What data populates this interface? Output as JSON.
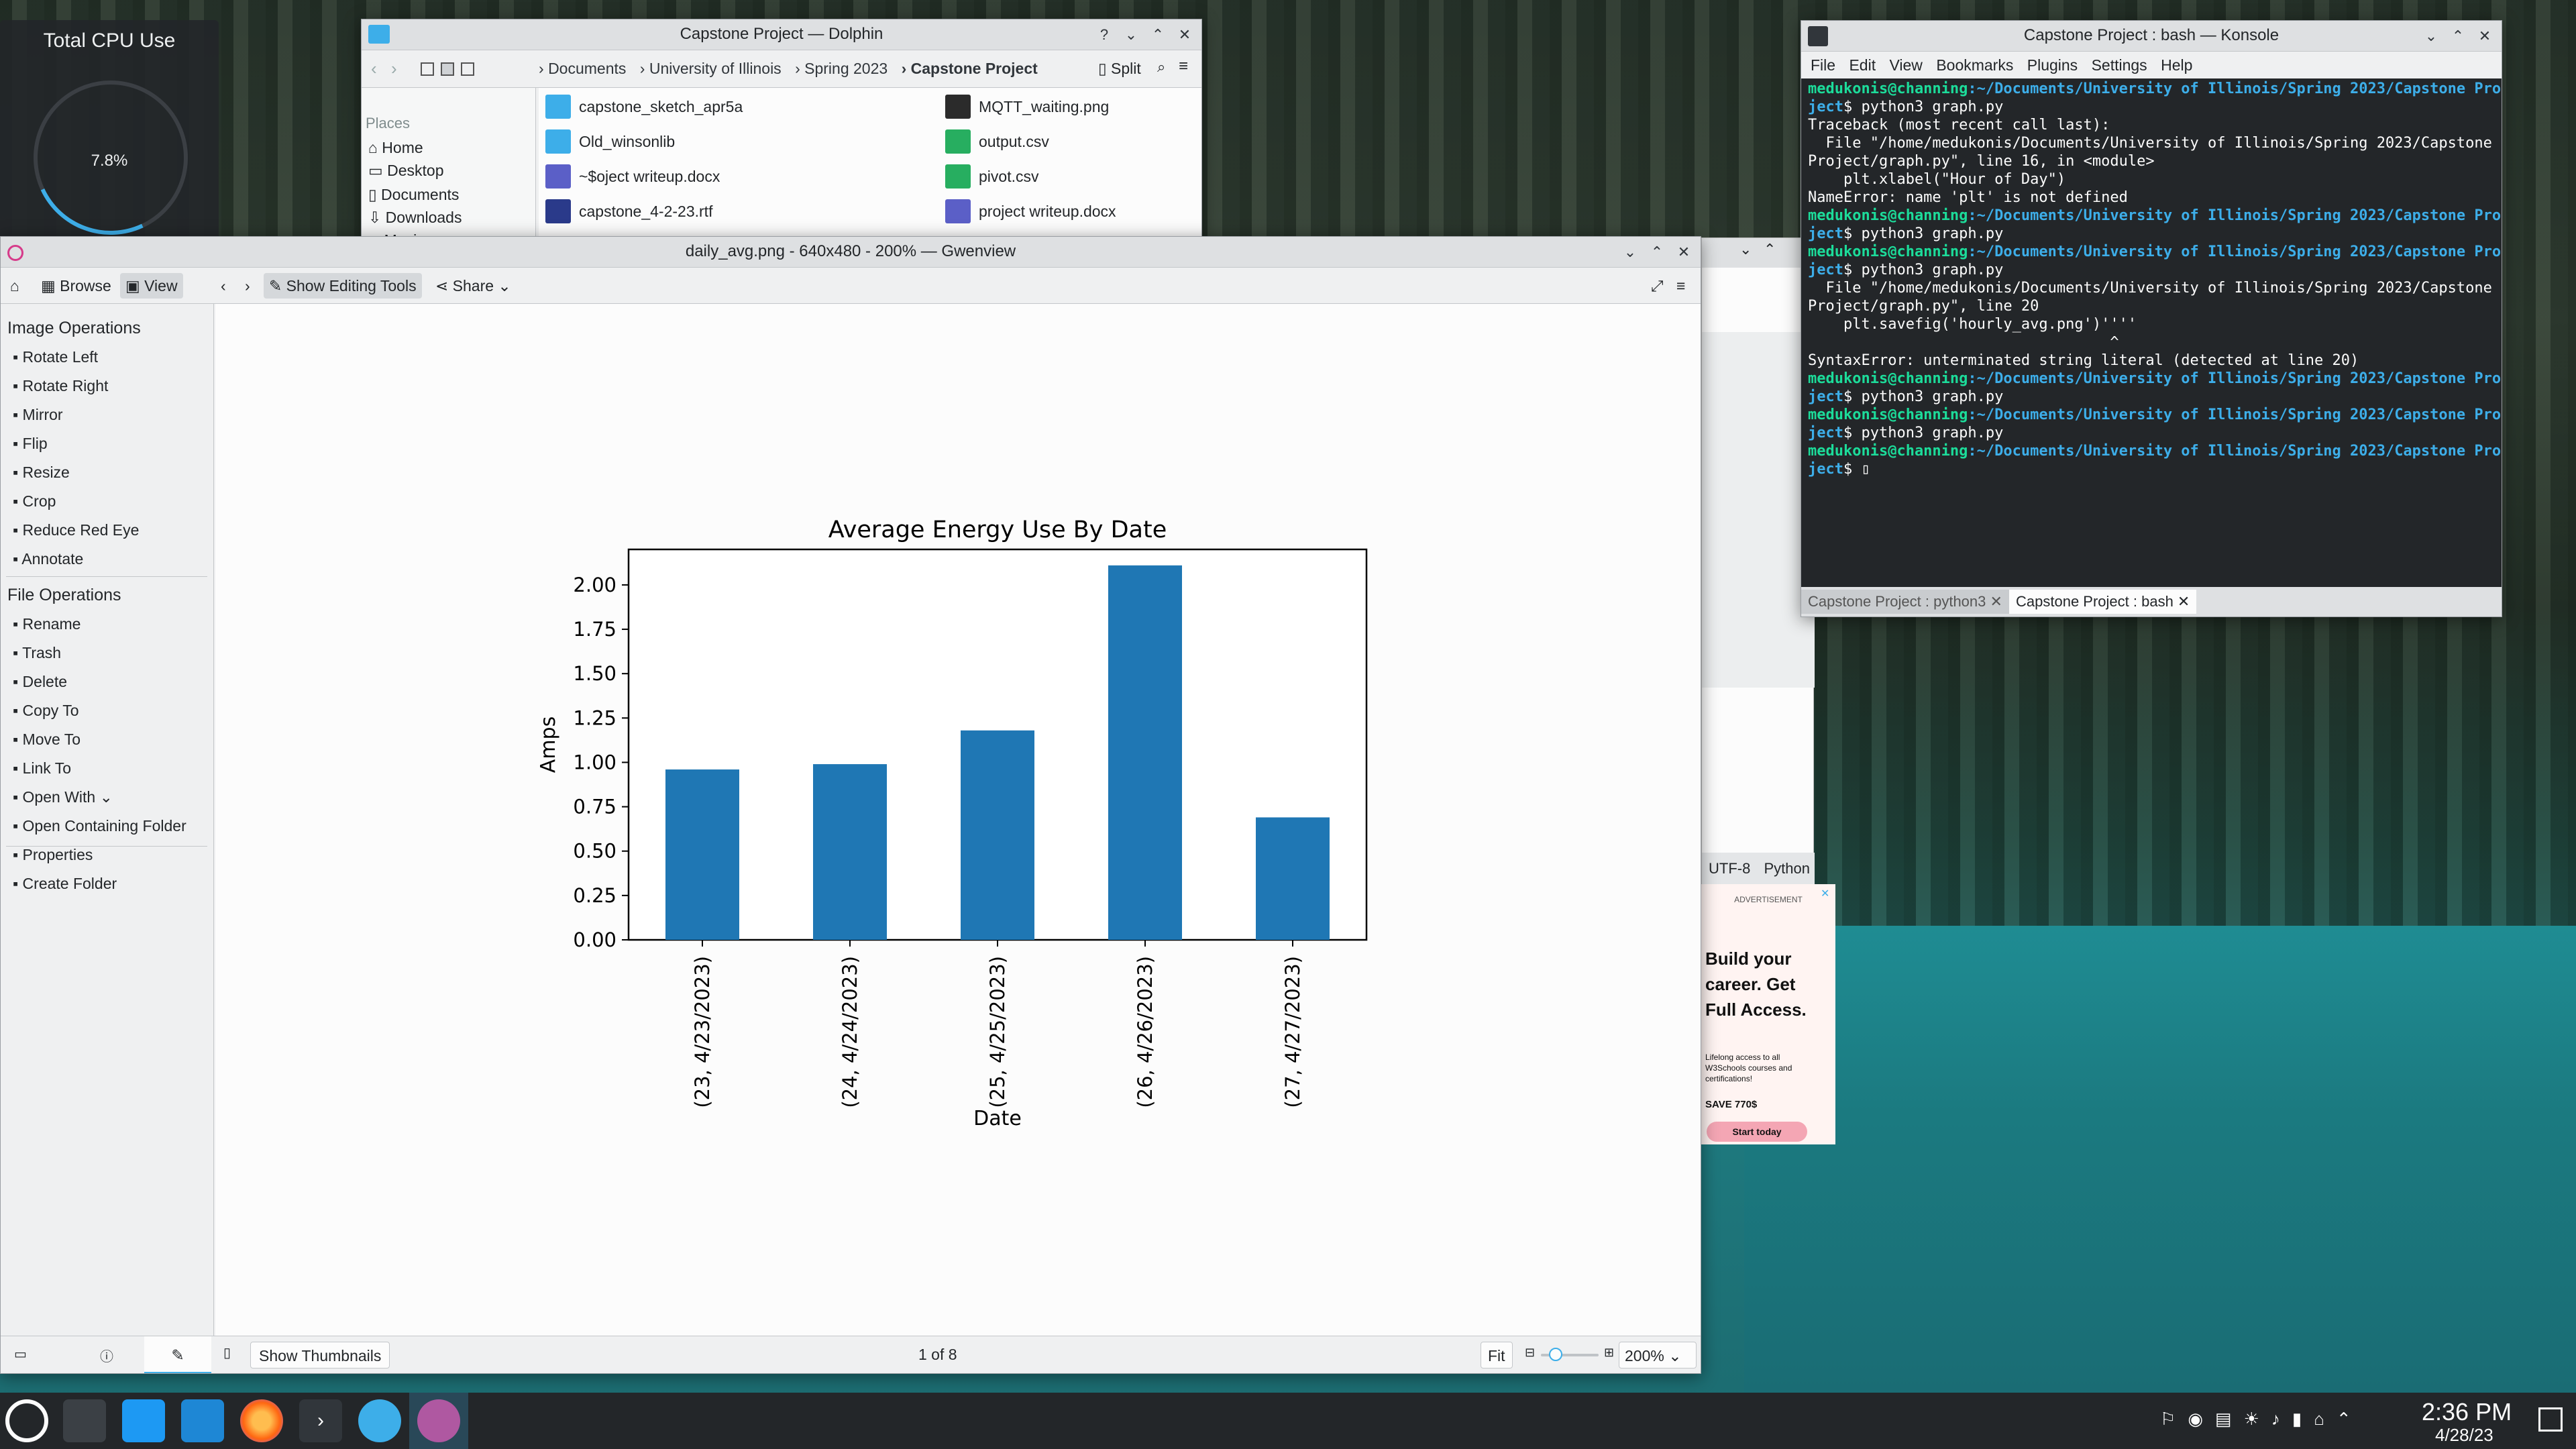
{
  "desktop": {
    "cpu_widget": {
      "title": "Total CPU Use",
      "value": "7.8%"
    }
  },
  "dolphin": {
    "title": "Capstone Project — Dolphin",
    "split_label": "Split",
    "breadcrumb": [
      "Documents",
      "University of Illinois",
      "Spring 2023",
      "Capstone Project"
    ],
    "places_header": "Places",
    "places": [
      "Home",
      "Desktop",
      "Documents",
      "Downloads",
      "Music"
    ],
    "files_left": [
      "capstone_sketch_apr5a",
      "Old_winsonlib",
      "~$oject writeup.docx",
      "capstone_4-2-23.rtf"
    ],
    "files_right": [
      "MQTT_waiting.png",
      "output.csv",
      "pivot.csv",
      "project writeup.docx"
    ]
  },
  "konsole": {
    "title": "Capstone Project : bash — Konsole",
    "menu": [
      "File",
      "Edit",
      "View",
      "Bookmarks",
      "Plugins",
      "Settings",
      "Help"
    ],
    "lines": [
      {
        "p": "medukonis@channing",
        "u": ":~/Documents/University of Illinois/Spring 2023/Capstone Pro"
      },
      {
        "u2": "ject",
        "t": "$ python3 graph.py"
      },
      {
        "t": "Traceback (most recent call last):"
      },
      {
        "t": "  File \"/home/medukonis/Documents/University of Illinois/Spring 2023/Capstone"
      },
      {
        "t": "Project/graph.py\", line 16, in <module>"
      },
      {
        "t": "    plt.xlabel(\"Hour of Day\")"
      },
      {
        "t": "NameError: name 'plt' is not defined"
      },
      {
        "p": "medukonis@channing",
        "u": ":~/Documents/University of Illinois/Spring 2023/Capstone Pro"
      },
      {
        "u2": "ject",
        "t": "$ python3 graph.py"
      },
      {
        "p": "medukonis@channing",
        "u": ":~/Documents/University of Illinois/Spring 2023/Capstone Pro"
      },
      {
        "u2": "ject",
        "t": "$ python3 graph.py"
      },
      {
        "t": "  File \"/home/medukonis/Documents/University of Illinois/Spring 2023/Capstone"
      },
      {
        "t": "Project/graph.py\", line 20"
      },
      {
        "t": "    plt.savefig('hourly_avg.png')''''"
      },
      {
        "t": "                                  ^"
      },
      {
        "t": "SyntaxError: unterminated string literal (detected at line 20)"
      },
      {
        "p": "medukonis@channing",
        "u": ":~/Documents/University of Illinois/Spring 2023/Capstone Pro"
      },
      {
        "u2": "ject",
        "t": "$ python3 graph.py"
      },
      {
        "p": "medukonis@channing",
        "u": ":~/Documents/University of Illinois/Spring 2023/Capstone Pro"
      },
      {
        "u2": "ject",
        "t": "$ python3 graph.py"
      },
      {
        "p": "medukonis@channing",
        "u": ":~/Documents/University of Illinois/Spring 2023/Capstone Pro"
      },
      {
        "u2": "ject",
        "t": "$ ▯"
      }
    ],
    "tabs": [
      "Capstone Project : python3",
      "Capstone Project : bash"
    ]
  },
  "behind": {
    "encoding": "UTF-8",
    "language": "Python"
  },
  "ad": {
    "label": "ADVERTISEMENT",
    "headline": "Build your career. Get Full Access.",
    "body": "Lifelong access to all W3Schools courses and certifications!",
    "save": "SAVE 770$",
    "cta": "Start today"
  },
  "gwenview": {
    "title": "daily_avg.png - 640x480 - 200% — Gwenview",
    "browse": "Browse",
    "view": "View",
    "editing": "Show Editing Tools",
    "share": "Share",
    "image_ops_header": "Image Operations",
    "image_ops": [
      "Rotate Left",
      "Rotate Right",
      "Mirror",
      "Flip",
      "Resize",
      "Crop",
      "Reduce Red Eye",
      "Annotate"
    ],
    "file_ops_header": "File Operations",
    "file_ops": [
      "Rename",
      "Trash",
      "Delete",
      "Copy To",
      "Move To",
      "Link To",
      "Open With",
      "Open Containing Folder",
      "Properties",
      "Create Folder"
    ],
    "show_thumbnails": "Show Thumbnails",
    "position": "1 of 8",
    "fit": "Fit",
    "zoom": "200%"
  },
  "chart_data": {
    "type": "bar",
    "title": "Average Energy Use By Date",
    "xlabel": "Date",
    "ylabel": "Amps",
    "categories": [
      "(23, 4/23/2023)",
      "(24, 4/24/2023)",
      "(25, 4/25/2023)",
      "(26, 4/26/2023)",
      "(27, 4/27/2023)"
    ],
    "values": [
      0.96,
      0.99,
      1.18,
      2.11,
      0.69
    ],
    "ylim": [
      0,
      2.2
    ],
    "yticks": [
      "0.00",
      "0.25",
      "0.50",
      "0.75",
      "1.00",
      "1.25",
      "1.50",
      "1.75",
      "2.00"
    ],
    "color": "#1f77b4"
  },
  "taskbar": {
    "time": "2:36 PM",
    "date": "4/28/23"
  }
}
